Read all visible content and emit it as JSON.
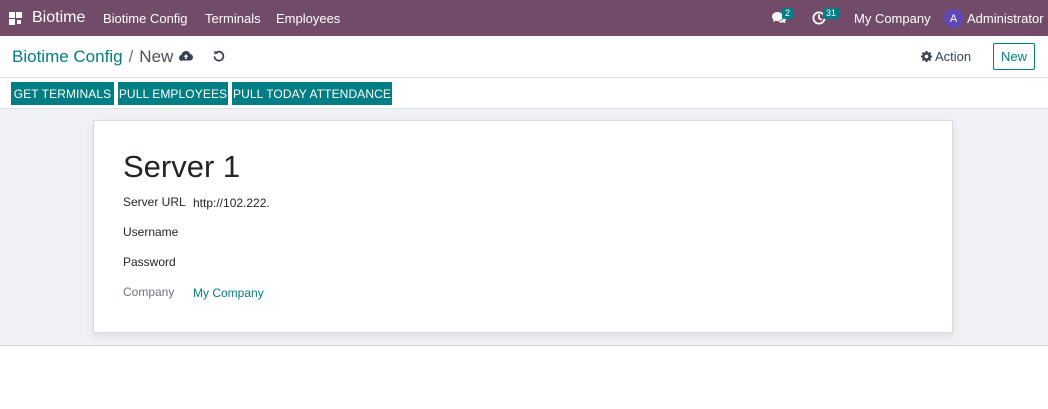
{
  "navbar": {
    "brand": "Biotime",
    "menu": [
      "Biotime Config",
      "Terminals",
      "Employees"
    ],
    "messages_count": "2",
    "activities_count": "31",
    "company": "My Company",
    "user_initial": "A",
    "user_name": "Administrator"
  },
  "breadcrumb": {
    "parent": "Biotime Config",
    "separator": "/",
    "current": "New"
  },
  "control_panel": {
    "action_label": "Action",
    "new_label": "New"
  },
  "header_buttons": [
    "GET TERMINALS",
    "PULL EMPLOYEES",
    "PULL TODAY ATTENDANCE"
  ],
  "form": {
    "title": "Server 1",
    "fields": [
      {
        "label": "Server URL",
        "value": "http://102.222."
      },
      {
        "label": "Username",
        "value": ""
      },
      {
        "label": "Password",
        "value": ""
      },
      {
        "label": "Company",
        "value": "My Company"
      }
    ]
  },
  "colors": {
    "navbar": "#714b67",
    "primary": "#017e84",
    "sheet_background": "#f1f2f5"
  },
  "icons": [
    "apps-grid-icon",
    "chat-icon",
    "clock-icon",
    "cloud-upload-icon",
    "undo-icon",
    "gear-icon"
  ]
}
